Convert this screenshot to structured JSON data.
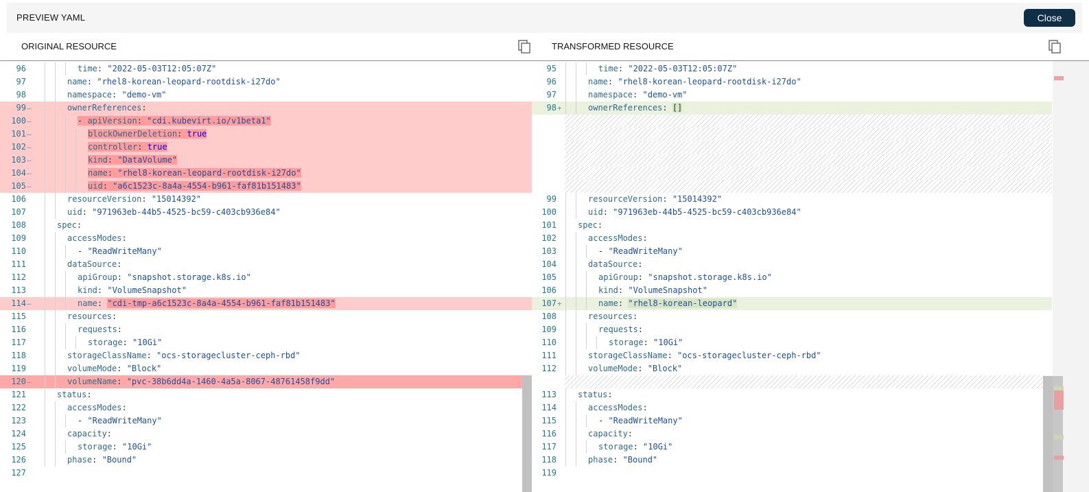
{
  "header": {
    "title": "PREVIEW YAML",
    "close_label": "Close"
  },
  "original": {
    "title": "ORIGINAL RESOURCE",
    "lines": [
      {
        "n": "96",
        "i": 3,
        "st": "n",
        "t": [
          [
            "k",
            "time"
          ],
          [
            "p",
            ": "
          ],
          [
            "s",
            "\"2022-05-03T12:05:07Z\""
          ]
        ]
      },
      {
        "n": "97",
        "i": 2,
        "st": "n",
        "t": [
          [
            "k",
            "name"
          ],
          [
            "p",
            ": "
          ],
          [
            "s",
            "\"rhel8-korean-leopard-rootdisk-i27do\""
          ]
        ]
      },
      {
        "n": "98",
        "i": 2,
        "st": "n",
        "t": [
          [
            "k",
            "namespace"
          ],
          [
            "p",
            ": "
          ],
          [
            "s",
            "\"demo-vm\""
          ]
        ]
      },
      {
        "n": "99",
        "i": 2,
        "st": "d",
        "t": [
          [
            "k",
            "ownerReferences"
          ],
          [
            "p",
            ":"
          ]
        ]
      },
      {
        "n": "100",
        "i": 3,
        "st": "d",
        "h": true,
        "t": [
          [
            "p",
            "- "
          ],
          [
            "k",
            "apiVersion"
          ],
          [
            "p",
            ": "
          ],
          [
            "s",
            "\"cdi.kubevirt.io/v1beta1\""
          ]
        ]
      },
      {
        "n": "101",
        "i": 4,
        "st": "d",
        "h": true,
        "t": [
          [
            "k",
            "blockOwnerDeletion"
          ],
          [
            "p",
            ": "
          ],
          [
            "b",
            "true"
          ]
        ]
      },
      {
        "n": "102",
        "i": 4,
        "st": "d",
        "h": true,
        "t": [
          [
            "k",
            "controller"
          ],
          [
            "p",
            ": "
          ],
          [
            "b",
            "true"
          ]
        ]
      },
      {
        "n": "103",
        "i": 4,
        "st": "d",
        "h": true,
        "t": [
          [
            "k",
            "kind"
          ],
          [
            "p",
            ": "
          ],
          [
            "s",
            "\"DataVolume\""
          ]
        ]
      },
      {
        "n": "104",
        "i": 4,
        "st": "d",
        "h": true,
        "t": [
          [
            "k",
            "name"
          ],
          [
            "p",
            ": "
          ],
          [
            "s",
            "\"rhel8-korean-leopard-rootdisk-i27do\""
          ]
        ]
      },
      {
        "n": "105",
        "i": 4,
        "st": "d",
        "h": true,
        "t": [
          [
            "k",
            "uid"
          ],
          [
            "p",
            ": "
          ],
          [
            "s",
            "\"a6c1523c-8a4a-4554-b961-faf81b151483\""
          ]
        ]
      },
      {
        "n": "106",
        "i": 2,
        "st": "n",
        "t": [
          [
            "k",
            "resourceVersion"
          ],
          [
            "p",
            ": "
          ],
          [
            "s",
            "\"15014392\""
          ]
        ]
      },
      {
        "n": "107",
        "i": 2,
        "st": "n",
        "t": [
          [
            "k",
            "uid"
          ],
          [
            "p",
            ": "
          ],
          [
            "s",
            "\"971963eb-44b5-4525-bc59-c403cb936e84\""
          ]
        ]
      },
      {
        "n": "108",
        "i": 1,
        "st": "n",
        "t": [
          [
            "k",
            "spec"
          ],
          [
            "p",
            ":"
          ]
        ]
      },
      {
        "n": "109",
        "i": 2,
        "st": "n",
        "t": [
          [
            "k",
            "accessModes"
          ],
          [
            "p",
            ":"
          ]
        ]
      },
      {
        "n": "110",
        "i": 3,
        "st": "n",
        "t": [
          [
            "p",
            "- "
          ],
          [
            "s",
            "\"ReadWriteMany\""
          ]
        ]
      },
      {
        "n": "111",
        "i": 2,
        "st": "n",
        "t": [
          [
            "k",
            "dataSource"
          ],
          [
            "p",
            ":"
          ]
        ]
      },
      {
        "n": "112",
        "i": 3,
        "st": "n",
        "t": [
          [
            "k",
            "apiGroup"
          ],
          [
            "p",
            ": "
          ],
          [
            "s",
            "\"snapshot.storage.k8s.io\""
          ]
        ]
      },
      {
        "n": "113",
        "i": 3,
        "st": "n",
        "t": [
          [
            "k",
            "kind"
          ],
          [
            "p",
            ": "
          ],
          [
            "s",
            "\"VolumeSnapshot\""
          ]
        ]
      },
      {
        "n": "114",
        "i": 3,
        "st": "d",
        "hv": true,
        "t": [
          [
            "k",
            "name"
          ],
          [
            "p",
            ": "
          ],
          [
            "s",
            "\"cdi-tmp-a6c1523c-8a4a-4554-b961-faf81b151483\""
          ]
        ]
      },
      {
        "n": "115",
        "i": 2,
        "st": "n",
        "t": [
          [
            "k",
            "resources"
          ],
          [
            "p",
            ":"
          ]
        ]
      },
      {
        "n": "116",
        "i": 3,
        "st": "n",
        "t": [
          [
            "k",
            "requests"
          ],
          [
            "p",
            ":"
          ]
        ]
      },
      {
        "n": "117",
        "i": 4,
        "st": "n",
        "t": [
          [
            "k",
            "storage"
          ],
          [
            "p",
            ": "
          ],
          [
            "s",
            "\"10Gi\""
          ]
        ]
      },
      {
        "n": "118",
        "i": 2,
        "st": "n",
        "t": [
          [
            "k",
            "storageClassName"
          ],
          [
            "p",
            ": "
          ],
          [
            "s",
            "\"ocs-storagecluster-ceph-rbd\""
          ]
        ]
      },
      {
        "n": "119",
        "i": 2,
        "st": "n",
        "t": [
          [
            "k",
            "volumeMode"
          ],
          [
            "p",
            ": "
          ],
          [
            "s",
            "\"Block\""
          ]
        ]
      },
      {
        "n": "120",
        "i": 2,
        "st": "d2",
        "t": [
          [
            "k",
            "volumeName"
          ],
          [
            "p",
            ": "
          ],
          [
            "s",
            "\"pvc-38b6dd4a-1460-4a5a-8067-48761458f9dd\""
          ]
        ]
      },
      {
        "n": "121",
        "i": 1,
        "st": "n",
        "t": [
          [
            "k",
            "status"
          ],
          [
            "p",
            ":"
          ]
        ]
      },
      {
        "n": "122",
        "i": 2,
        "st": "n",
        "t": [
          [
            "k",
            "accessModes"
          ],
          [
            "p",
            ":"
          ]
        ]
      },
      {
        "n": "123",
        "i": 3,
        "st": "n",
        "t": [
          [
            "p",
            "- "
          ],
          [
            "s",
            "\"ReadWriteMany\""
          ]
        ]
      },
      {
        "n": "124",
        "i": 2,
        "st": "n",
        "t": [
          [
            "k",
            "capacity"
          ],
          [
            "p",
            ":"
          ]
        ]
      },
      {
        "n": "125",
        "i": 3,
        "st": "n",
        "t": [
          [
            "k",
            "storage"
          ],
          [
            "p",
            ": "
          ],
          [
            "s",
            "\"10Gi\""
          ]
        ]
      },
      {
        "n": "126",
        "i": 2,
        "st": "n",
        "t": [
          [
            "k",
            "phase"
          ],
          [
            "p",
            ": "
          ],
          [
            "s",
            "\"Bound\""
          ]
        ]
      },
      {
        "n": "127",
        "i": 0,
        "st": "n",
        "t": []
      }
    ]
  },
  "transformed": {
    "title": "TRANSFORMED RESOURCE",
    "lines": [
      {
        "n": "95",
        "i": 3,
        "st": "n",
        "t": [
          [
            "k",
            "time"
          ],
          [
            "p",
            ": "
          ],
          [
            "s",
            "\"2022-05-03T12:05:07Z\""
          ]
        ]
      },
      {
        "n": "96",
        "i": 2,
        "st": "n",
        "t": [
          [
            "k",
            "name"
          ],
          [
            "p",
            ": "
          ],
          [
            "s",
            "\"rhel8-korean-leopard-rootdisk-i27do\""
          ]
        ]
      },
      {
        "n": "97",
        "i": 2,
        "st": "n",
        "t": [
          [
            "k",
            "namespace"
          ],
          [
            "p",
            ": "
          ],
          [
            "s",
            "\"demo-vm\""
          ]
        ]
      },
      {
        "n": "98",
        "i": 2,
        "st": "i",
        "hv": true,
        "t": [
          [
            "k",
            "ownerReferences"
          ],
          [
            "p",
            ": "
          ],
          [
            "p",
            "[]"
          ]
        ]
      },
      {
        "n": "",
        "st": "gap"
      },
      {
        "n": "",
        "st": "gap"
      },
      {
        "n": "",
        "st": "gap"
      },
      {
        "n": "",
        "st": "gap"
      },
      {
        "n": "",
        "st": "gap"
      },
      {
        "n": "",
        "st": "gap"
      },
      {
        "n": "99",
        "i": 2,
        "st": "n",
        "t": [
          [
            "k",
            "resourceVersion"
          ],
          [
            "p",
            ": "
          ],
          [
            "s",
            "\"15014392\""
          ]
        ]
      },
      {
        "n": "100",
        "i": 2,
        "st": "n",
        "t": [
          [
            "k",
            "uid"
          ],
          [
            "p",
            ": "
          ],
          [
            "s",
            "\"971963eb-44b5-4525-bc59-c403cb936e84\""
          ]
        ]
      },
      {
        "n": "101",
        "i": 1,
        "st": "n",
        "t": [
          [
            "k",
            "spec"
          ],
          [
            "p",
            ":"
          ]
        ]
      },
      {
        "n": "102",
        "i": 2,
        "st": "n",
        "t": [
          [
            "k",
            "accessModes"
          ],
          [
            "p",
            ":"
          ]
        ]
      },
      {
        "n": "103",
        "i": 3,
        "st": "n",
        "t": [
          [
            "p",
            "- "
          ],
          [
            "s",
            "\"ReadWriteMany\""
          ]
        ]
      },
      {
        "n": "104",
        "i": 2,
        "st": "n",
        "t": [
          [
            "k",
            "dataSource"
          ],
          [
            "p",
            ":"
          ]
        ]
      },
      {
        "n": "105",
        "i": 3,
        "st": "n",
        "t": [
          [
            "k",
            "apiGroup"
          ],
          [
            "p",
            ": "
          ],
          [
            "s",
            "\"snapshot.storage.k8s.io\""
          ]
        ]
      },
      {
        "n": "106",
        "i": 3,
        "st": "n",
        "t": [
          [
            "k",
            "kind"
          ],
          [
            "p",
            ": "
          ],
          [
            "s",
            "\"VolumeSnapshot\""
          ]
        ]
      },
      {
        "n": "107",
        "i": 3,
        "st": "i",
        "hv": true,
        "t": [
          [
            "k",
            "name"
          ],
          [
            "p",
            ": "
          ],
          [
            "s",
            "\"rhel8-korean-leopard\""
          ]
        ]
      },
      {
        "n": "108",
        "i": 2,
        "st": "n",
        "t": [
          [
            "k",
            "resources"
          ],
          [
            "p",
            ":"
          ]
        ]
      },
      {
        "n": "109",
        "i": 3,
        "st": "n",
        "t": [
          [
            "k",
            "requests"
          ],
          [
            "p",
            ":"
          ]
        ]
      },
      {
        "n": "110",
        "i": 4,
        "st": "n",
        "t": [
          [
            "k",
            "storage"
          ],
          [
            "p",
            ": "
          ],
          [
            "s",
            "\"10Gi\""
          ]
        ]
      },
      {
        "n": "111",
        "i": 2,
        "st": "n",
        "t": [
          [
            "k",
            "storageClassName"
          ],
          [
            "p",
            ": "
          ],
          [
            "s",
            "\"ocs-storagecluster-ceph-rbd\""
          ]
        ]
      },
      {
        "n": "112",
        "i": 2,
        "st": "n",
        "t": [
          [
            "k",
            "volumeMode"
          ],
          [
            "p",
            ": "
          ],
          [
            "s",
            "\"Block\""
          ]
        ]
      },
      {
        "n": "",
        "st": "gap"
      },
      {
        "n": "113",
        "i": 1,
        "st": "n",
        "t": [
          [
            "k",
            "status"
          ],
          [
            "p",
            ":"
          ]
        ]
      },
      {
        "n": "114",
        "i": 2,
        "st": "n",
        "t": [
          [
            "k",
            "accessModes"
          ],
          [
            "p",
            ":"
          ]
        ]
      },
      {
        "n": "115",
        "i": 3,
        "st": "n",
        "t": [
          [
            "p",
            "- "
          ],
          [
            "s",
            "\"ReadWriteMany\""
          ]
        ]
      },
      {
        "n": "116",
        "i": 2,
        "st": "n",
        "t": [
          [
            "k",
            "capacity"
          ],
          [
            "p",
            ":"
          ]
        ]
      },
      {
        "n": "117",
        "i": 3,
        "st": "n",
        "t": [
          [
            "k",
            "storage"
          ],
          [
            "p",
            ": "
          ],
          [
            "s",
            "\"10Gi\""
          ]
        ]
      },
      {
        "n": "118",
        "i": 2,
        "st": "n",
        "t": [
          [
            "k",
            "phase"
          ],
          [
            "p",
            ": "
          ],
          [
            "s",
            "\"Bound\""
          ]
        ]
      },
      {
        "n": "119",
        "i": 0,
        "st": "n",
        "t": []
      }
    ]
  },
  "colors": {
    "deleted": "#ffcccc",
    "deleted_strong": "#ffa8a8",
    "inserted": "#eaf1dd",
    "accent": "#0f2e47"
  },
  "icons": {
    "copy_original": "copy-icon",
    "copy_transformed": "copy-icon"
  }
}
